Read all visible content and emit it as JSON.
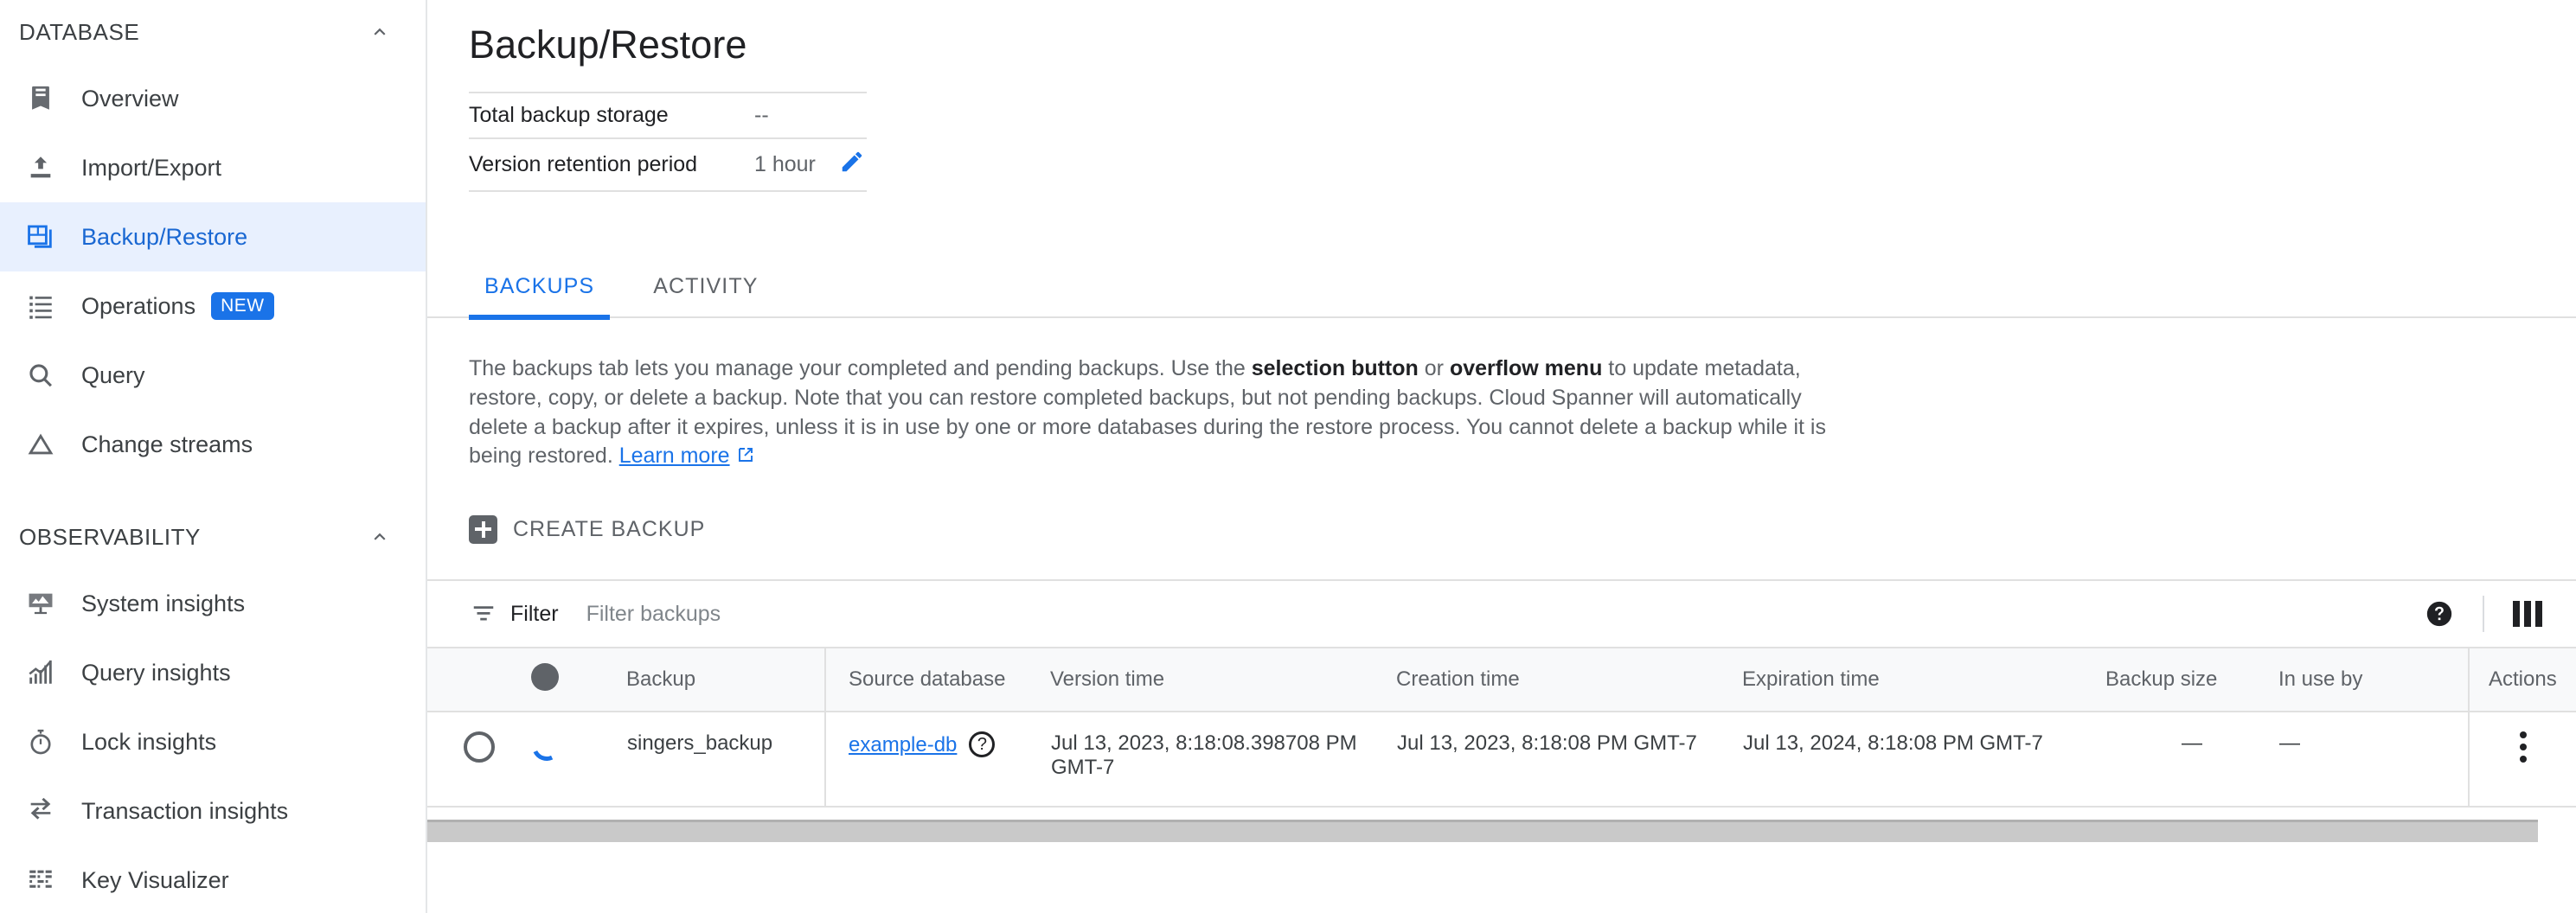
{
  "sidebar": {
    "sections": [
      {
        "title": "DATABASE",
        "collapse_icon": "chevron-up-icon",
        "items": [
          {
            "label": "Overview",
            "icon": "overview-icon",
            "active": false,
            "badge": ""
          },
          {
            "label": "Import/Export",
            "icon": "import-export-icon",
            "active": false,
            "badge": ""
          },
          {
            "label": "Backup/Restore",
            "icon": "backup-restore-icon",
            "active": true,
            "badge": ""
          },
          {
            "label": "Operations",
            "icon": "list-icon",
            "active": false,
            "badge": "NEW"
          },
          {
            "label": "Query",
            "icon": "search-icon",
            "active": false,
            "badge": ""
          },
          {
            "label": "Change streams",
            "icon": "triangle-icon",
            "active": false,
            "badge": ""
          }
        ]
      },
      {
        "title": "OBSERVABILITY",
        "collapse_icon": "chevron-up-icon",
        "items": [
          {
            "label": "System insights",
            "icon": "monitor-chart-icon",
            "active": false,
            "badge": ""
          },
          {
            "label": "Query insights",
            "icon": "bar-chart-icon",
            "active": false,
            "badge": ""
          },
          {
            "label": "Lock insights",
            "icon": "stopwatch-icon",
            "active": false,
            "badge": ""
          },
          {
            "label": "Transaction insights",
            "icon": "swap-arrows-icon",
            "active": false,
            "badge": ""
          },
          {
            "label": "Key Visualizer",
            "icon": "heatmap-grid-icon",
            "active": false,
            "badge": ""
          }
        ]
      }
    ]
  },
  "page": {
    "title": "Backup/Restore",
    "summary_rows": [
      {
        "label": "Total backup storage",
        "value": "--",
        "editable": false
      },
      {
        "label": "Version retention period",
        "value": "1 hour",
        "editable": true,
        "edit_icon": "pencil-icon"
      }
    ]
  },
  "tabs": [
    {
      "label": "BACKUPS",
      "selected": true
    },
    {
      "label": "ACTIVITY",
      "selected": false
    }
  ],
  "description": {
    "part1": "The backups tab lets you manage your completed and pending backups. Use the ",
    "bold1": "selection button",
    "part2": " or ",
    "bold2": "overflow menu",
    "part3": " to update metadata, restore, copy, or delete a backup. Note that you can restore completed backups, but not pending backups. Cloud Spanner will automatically delete a backup after it expires, unless it is in use by one or more databases during the restore process. You cannot delete a backup while it is being restored. ",
    "link": "Learn more",
    "link_icon": "external-link-icon"
  },
  "toolbar": {
    "create_backup_label": "CREATE BACKUP",
    "create_backup_icon": "plus-square-icon"
  },
  "filter": {
    "icon": "filter-icon",
    "label": "Filter",
    "placeholder": "Filter backups",
    "value": "",
    "help_icon": "help-circle-icon",
    "columns_icon": "column-settings-icon"
  },
  "table": {
    "columns": [
      "",
      "",
      "Backup",
      "Source database",
      "Version time",
      "Creation time",
      "Expiration time",
      "Backup size",
      "In use by",
      "Actions"
    ],
    "header_status_icon": "status-dot-icon",
    "rows": [
      {
        "select_icon": "radio-unchecked-icon",
        "status_icon": "loading-spinner-icon",
        "backup": "singers_backup",
        "source_database": "example-db",
        "source_database_help_icon": "help-circle-outline-icon",
        "version_time": "Jul 13, 2023, 8:18:08.398708 PM GMT-7",
        "creation_time": "Jul 13, 2023, 8:18:08 PM GMT-7",
        "expiration_time": "Jul 13, 2024, 8:18:08 PM GMT-7",
        "backup_size": "—",
        "in_use_by": "—",
        "actions_icon": "kebab-menu-icon"
      }
    ]
  },
  "colors": {
    "accent": "#1a73e8",
    "active_nav_bg": "#e8f0fe",
    "active_nav_text": "#1967d2",
    "muted_text": "#5f6368",
    "border": "#e0e0e0",
    "header_bg": "#f8f9fa"
  }
}
